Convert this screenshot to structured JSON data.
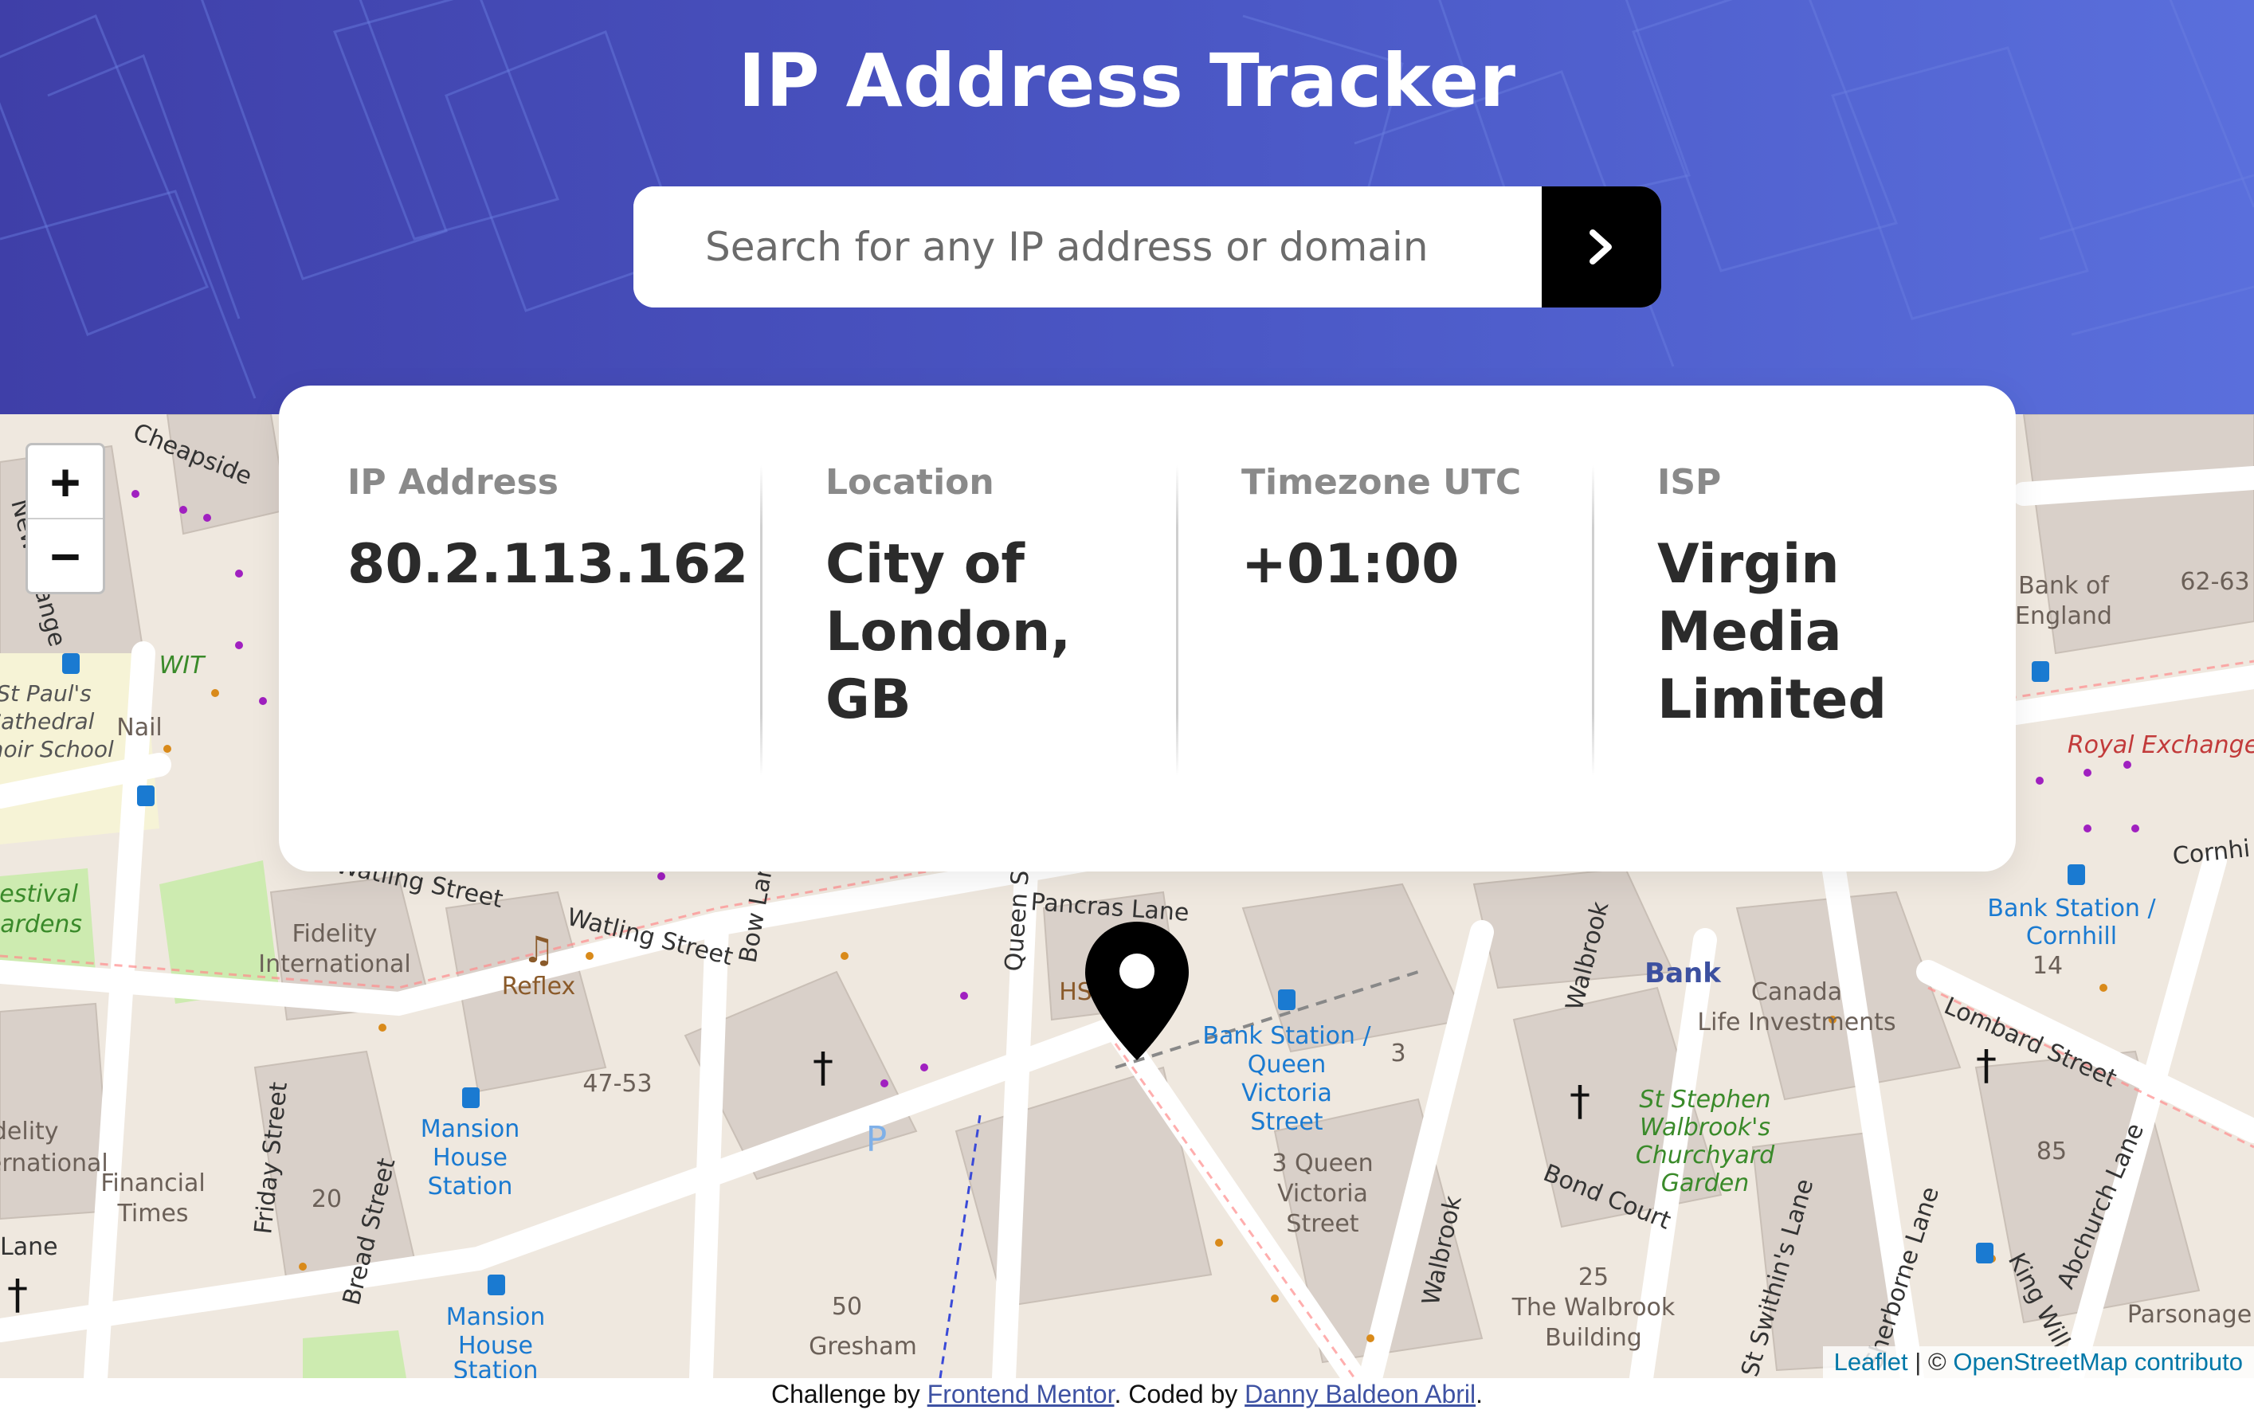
{
  "header": {
    "title": "IP Address Tracker",
    "gradient_colors": [
      "#3f3fa8",
      "#5a6fdc"
    ]
  },
  "search": {
    "placeholder": "Search for any IP address or domain",
    "value": "",
    "submit_icon": "chevron-right-icon",
    "button_color": "#000000"
  },
  "info": {
    "ip_label": "IP Address",
    "ip_value": "80.2.113.162",
    "location_label": "Location",
    "location_value": "City of London, GB",
    "timezone_label": "Timezone UTC",
    "timezone_value": "+01:00",
    "isp_label": "ISP",
    "isp_value": "Virgin Media Limited"
  },
  "map": {
    "zoom_in": "+",
    "zoom_out": "−",
    "marker_icon": "location-pin-icon",
    "attribution": {
      "leaflet": "Leaflet",
      "separator": " | © ",
      "osm": "OpenStreetMap contributo"
    },
    "labels": {
      "cheapside": "Cheapside",
      "new_change": "New Change",
      "wit": "WIT",
      "st_pauls_1": "St Paul's",
      "st_pauls_2": "Cathedral",
      "st_pauls_3": "Choir School",
      "nail": "Nail",
      "festival_1": "Festival",
      "festival_2": "Gardens",
      "watling_street_1": "Watling Street",
      "watling_street_2": "Watling Street",
      "bow_lane": "Bow Lane",
      "queen_street": "Queen St",
      "pancras_lane": "Pancras Lane",
      "fidelity_1": "Fidelity",
      "fidelity_2": "International",
      "fidelity_left_1": "Fidelity",
      "fidelity_left_2": "International",
      "reflex": "Reflex",
      "n4753": "47-53",
      "hs": "HS",
      "mansion_1": "Mansion",
      "mansion_2": "House",
      "mansion_3": "Station",
      "mansion_b1": "Mansion",
      "mansion_b2": "House",
      "mansion_b3": "Station",
      "friday_street": "Friday Street",
      "bread_street": "Bread Street",
      "n20": "20",
      "financial_1": "Financial",
      "financial_2": "Times",
      "lane_left": "Lane",
      "n50": "50",
      "gresham": "Gresham",
      "bank_station_queen_1": "Bank Station /",
      "bank_station_queen_2": "Queen",
      "bank_station_queen_3": "Victoria",
      "bank_station_queen_4": "Street",
      "three_queen_1": "3 Queen",
      "three_queen_2": "Victoria",
      "three_queen_3": "Street",
      "n3": "3",
      "walbrook_1": "Walbrook",
      "walbrook_2": "Walbrook",
      "bank": "Bank",
      "canada_1": "Canada",
      "canada_2": "Life Investments",
      "st_stephen_1": "St Stephen",
      "st_stephen_2": "Walbrook's",
      "st_stephen_3": "Churchyard",
      "st_stephen_4": "Garden",
      "bond_court": "Bond Court",
      "n25": "25",
      "walbrook_bldg_1": "The Walbrook",
      "walbrook_bldg_2": "Building",
      "bank_station_corn_1": "Bank Station /",
      "bank_station_corn_2": "Cornhill",
      "n14": "14",
      "lombard": "Lombard Street",
      "n85": "85",
      "abchurch": "Abchurch Lane",
      "king_william": "King Will",
      "sherborne": "Sherborne Lane",
      "st_swithins": "St Swithin's Lane",
      "parsonage": "Parsonage",
      "bank_of_england_1": "Bank of",
      "bank_of_england_2": "England",
      "royal_exchange": "Royal Exchange",
      "cornhill": "Cornhi",
      "n6263": "62-63"
    }
  },
  "footer": {
    "prefix": "Challenge by ",
    "link1": "Frontend Mentor",
    "middle": ". Coded by ",
    "link2": "Danny Baldeon Abril",
    "suffix": "."
  }
}
